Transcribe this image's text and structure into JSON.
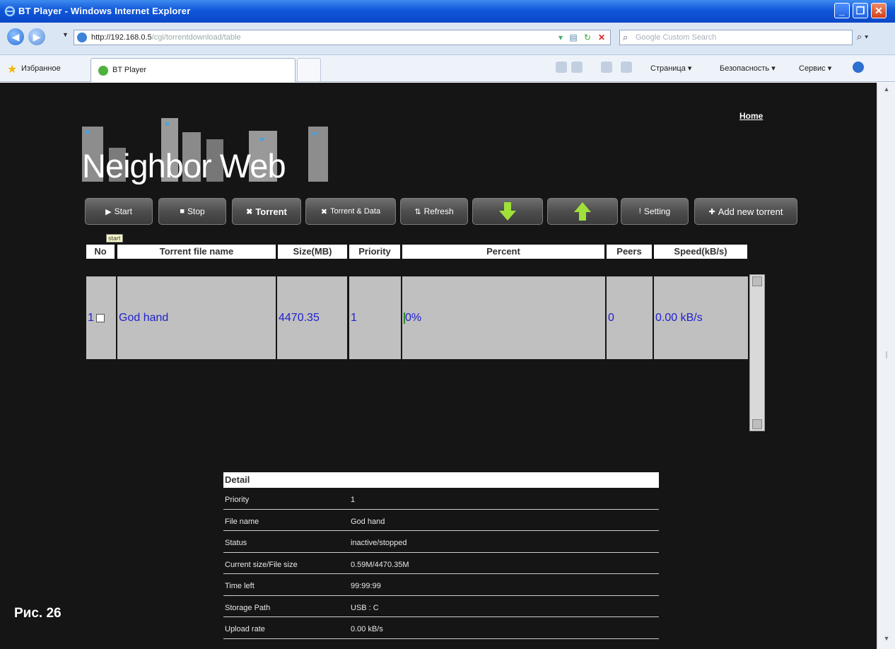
{
  "window": {
    "title": "BT Player - Windows Internet Explorer",
    "minimize": "_",
    "maximize": "❐",
    "close": "✕"
  },
  "address": {
    "url_main": "http://192.168.0.5",
    "url_rest": "/cgi/torrentdownload/table",
    "search_placeholder": "Google Custom Search"
  },
  "favorites": {
    "label": "Избранное",
    "tab_label": "BT Player",
    "commands": [
      "Страница ▾",
      "Безопасность ▾",
      "Сервис ▾"
    ]
  },
  "page": {
    "home_link": "Home",
    "logo_text": "Neighbor Web",
    "tooltip": "start",
    "toolbar": [
      {
        "label": "Start",
        "icon": "▶"
      },
      {
        "label": "Stop",
        "icon": "■"
      },
      {
        "label": "Torrent",
        "icon": "✖"
      },
      {
        "label": "Torrent & Data",
        "icon": "✖"
      },
      {
        "label": "Refresh",
        "icon": "⇅"
      },
      {
        "label": "",
        "icon": "down-arrow-icon"
      },
      {
        "label": "",
        "icon": "up-arrow-icon"
      },
      {
        "label": "Setting",
        "icon": "!"
      },
      {
        "label": "Add new torrent",
        "icon": "✚"
      }
    ],
    "table": {
      "headers": [
        "No",
        "Torrent file name",
        "Size(MB)",
        "Priority",
        "Percent",
        "Peers",
        "Speed(kB/s)"
      ],
      "rows": [
        {
          "no": "1",
          "name": "God hand",
          "size": "4470.35",
          "priority": "1",
          "percent": "0%",
          "peers": "0",
          "speed": "0.00 kB/s"
        }
      ]
    },
    "detail": {
      "title": "Detail",
      "rows": [
        {
          "key": "Priority",
          "value": "1"
        },
        {
          "key": "File name",
          "value": "God hand"
        },
        {
          "key": "Status",
          "value": "inactive/stopped"
        },
        {
          "key": "Current size/File size",
          "value": "0.59M/4470.35M"
        },
        {
          "key": "Time left",
          "value": "99:99:99"
        },
        {
          "key": "Storage Path",
          "value": "USB : C"
        },
        {
          "key": "Upload rate",
          "value": "0.00 kB/s"
        }
      ]
    },
    "caption": "Рис. 26"
  },
  "colors": {
    "page_bg": "#151515",
    "row_bg": "#c0c0c0",
    "row_text": "#2020d0",
    "arrow_green": "#9fe03a"
  }
}
